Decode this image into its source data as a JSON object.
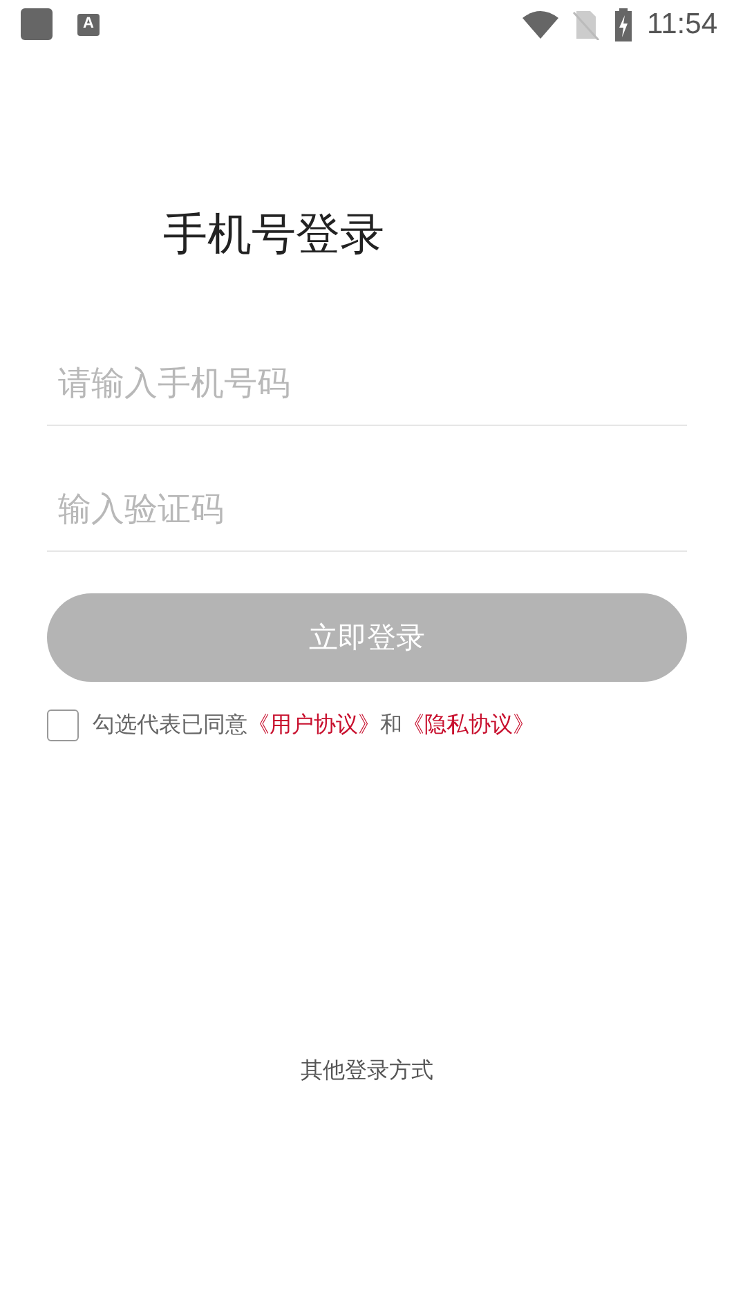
{
  "status_bar": {
    "keyboard_label": "A",
    "time": "11:54"
  },
  "title": "手机号登录",
  "phone_field": {
    "placeholder": "请输入手机号码"
  },
  "code_field": {
    "placeholder": "输入验证码"
  },
  "login_button": {
    "label": "立即登录",
    "disabled": true
  },
  "agreement": {
    "checked": false,
    "text": "勾选代表已同意",
    "link_1": "《用户协议》",
    "joiner": "和",
    "link_2": "《隐私协议》"
  },
  "other_login": "其他登录方式"
}
